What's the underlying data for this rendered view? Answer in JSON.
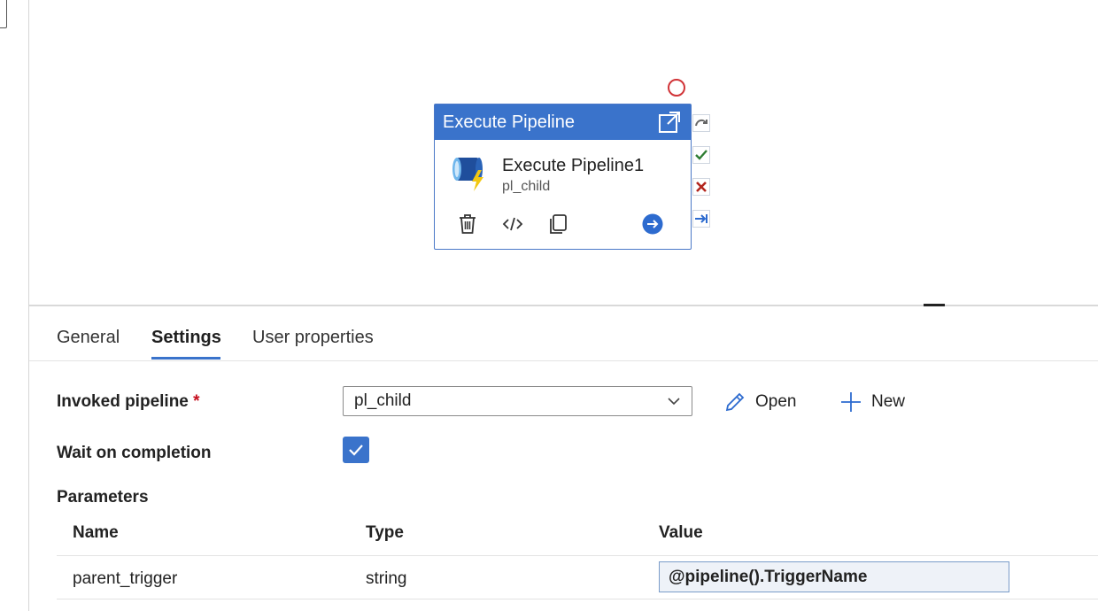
{
  "node": {
    "header_title": "Execute Pipeline",
    "activity_name": "Execute Pipeline1",
    "pipeline_ref": "pl_child",
    "header_color": "#3a73cb"
  },
  "tabs": [
    {
      "label": "General"
    },
    {
      "label": "Settings"
    },
    {
      "label": "User properties"
    }
  ],
  "active_tab": "Settings",
  "settings": {
    "invoked_pipeline_label": "Invoked pipeline",
    "required_mark": "*",
    "invoked_pipeline_value": "pl_child",
    "open_label": "Open",
    "new_label": "New",
    "wait_label": "Wait on completion",
    "wait_checked": true
  },
  "parameters": {
    "section_label": "Parameters",
    "columns": [
      "Name",
      "Type",
      "Value"
    ],
    "rows": [
      {
        "name": "parent_trigger",
        "type": "string",
        "value": "@pipeline().TriggerName"
      }
    ]
  },
  "colors": {
    "accent": "#3a73cb",
    "error": "#d13438",
    "success": "#2e7d32"
  }
}
